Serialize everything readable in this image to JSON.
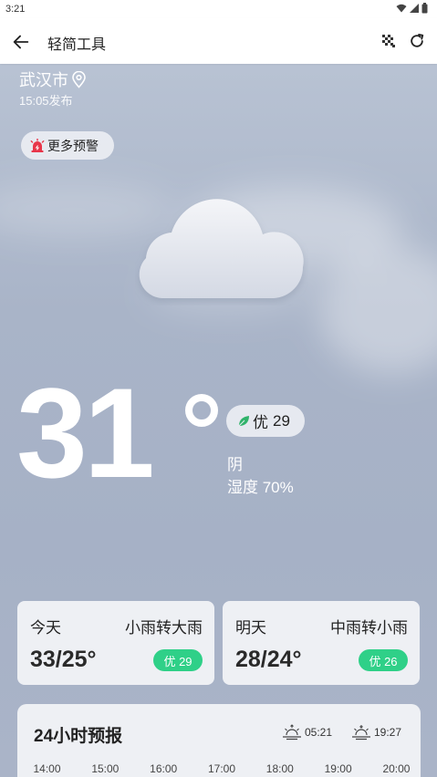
{
  "status_bar": {
    "time": "3:21"
  },
  "app_bar": {
    "title": "轻简工具"
  },
  "location": {
    "city": "武汉市",
    "publish_time": "15:05发布"
  },
  "alert": {
    "label": "更多预警"
  },
  "current": {
    "temperature": "31",
    "aqi_label": "优",
    "aqi_value": "29",
    "condition": "阴",
    "humidity": "湿度 70%"
  },
  "days": [
    {
      "day": "今天",
      "desc": "小雨转大雨",
      "range": "33/25°",
      "aqi": "优 29"
    },
    {
      "day": "明天",
      "desc": "中雨转小雨",
      "range": "28/24°",
      "aqi": "优 26"
    }
  ],
  "forecast": {
    "heading": "24小时预报",
    "sunrise": "05:21",
    "sunset": "19:27",
    "hours": [
      "14:00",
      "15:00",
      "16:00",
      "17:00",
      "18:00",
      "19:00",
      "20:00"
    ]
  },
  "colors": {
    "aqi_good": "#2fd088",
    "alert_red": "#e8364a"
  },
  "icons": [
    "back-arrow-icon",
    "grid-icon",
    "refresh-icon",
    "location-pin-icon",
    "alert-siren-icon",
    "cloud-icon",
    "leaf-icon",
    "sunrise-icon",
    "sunset-icon"
  ]
}
